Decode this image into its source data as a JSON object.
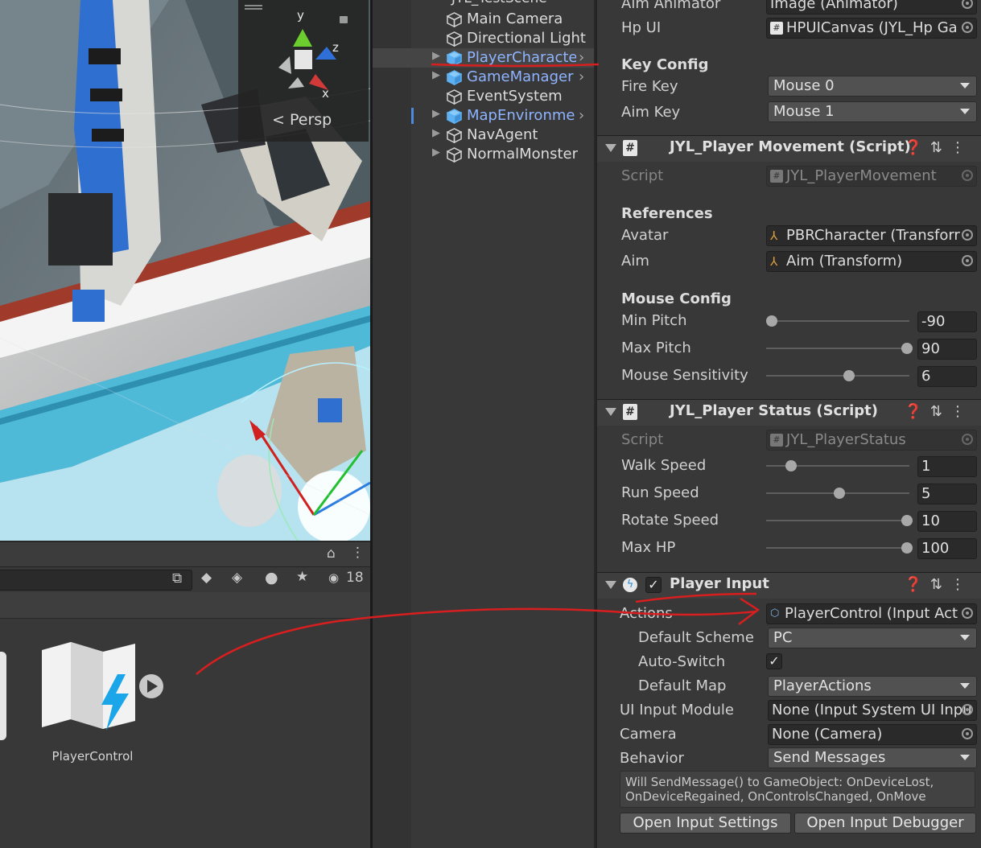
{
  "scene": {
    "gizmo_axes": {
      "x": "x",
      "y": "y",
      "z": "z"
    },
    "projection_label": "Persp"
  },
  "project": {
    "visible_count": "18",
    "asset": {
      "name": "PlayerControl",
      "icon": "input-actions-asset-icon"
    }
  },
  "hierarchy": {
    "scene_name": "JYL_TestScene",
    "items": [
      {
        "name": "Main Camera",
        "prefab": false
      },
      {
        "name": "Directional Light",
        "prefab": false
      },
      {
        "name": "PlayerCharacte",
        "prefab": true,
        "selected": true
      },
      {
        "name": "GameManager",
        "prefab": true
      },
      {
        "name": "EventSystem",
        "prefab": false
      },
      {
        "name": "MapEnvironme",
        "prefab": true
      },
      {
        "name": "NavAgent",
        "prefab": false
      },
      {
        "name": "NormalMonster",
        "prefab": false
      }
    ]
  },
  "inspector": {
    "top": {
      "aim_animator_label": "Aim Animator",
      "aim_animator_value": "Image (Animator)",
      "hp_ui_label": "Hp UI",
      "hp_ui_value": "HPUICanvas (JYL_Hp Ga"
    },
    "key_config": {
      "heading": "Key Config",
      "fire_key_label": "Fire Key",
      "fire_key_value": "Mouse 0",
      "aim_key_label": "Aim Key",
      "aim_key_value": "Mouse 1"
    },
    "movement": {
      "title": "JYL_Player Movement (Script)",
      "script_label": "Script",
      "script_value": "JYL_PlayerMovement",
      "references_heading": "References",
      "avatar_label": "Avatar",
      "avatar_value": "PBRCharacter (Transforr",
      "aim_label": "Aim",
      "aim_value": "Aim (Transform)",
      "mouse_heading": "Mouse Config",
      "sliders": [
        {
          "label": "Min Pitch",
          "value": "-90",
          "fraction": 0.0
        },
        {
          "label": "Max Pitch",
          "value": "90",
          "fraction": 1.0
        },
        {
          "label": "Mouse Sensitivity",
          "value": "6",
          "fraction": 0.57
        }
      ]
    },
    "status": {
      "title": "JYL_Player Status (Script)",
      "script_label": "Script",
      "script_value": "JYL_PlayerStatus",
      "sliders": [
        {
          "label": "Walk Speed",
          "value": "1",
          "fraction": 0.14
        },
        {
          "label": "Run Speed",
          "value": "5",
          "fraction": 0.5
        },
        {
          "label": "Rotate Speed",
          "value": "10",
          "fraction": 1.0
        },
        {
          "label": "Max HP",
          "value": "100",
          "fraction": 1.0
        }
      ]
    },
    "player_input": {
      "title": "Player Input",
      "enabled": true,
      "actions_label": "Actions",
      "actions_value": "PlayerControl (Input Act",
      "default_scheme_label": "Default Scheme",
      "default_scheme_value": "PC",
      "auto_switch_label": "Auto-Switch",
      "auto_switch": true,
      "default_map_label": "Default Map",
      "default_map_value": "PlayerActions",
      "ui_module_label": "UI Input Module",
      "ui_module_value": "None (Input System UI Inpu",
      "camera_label": "Camera",
      "camera_value": "None (Camera)",
      "behavior_label": "Behavior",
      "behavior_value": "Send Messages",
      "help_text": "Will SendMessage() to GameObject: OnDeviceLost, OnDeviceRegained, OnControlsChanged, OnMove",
      "open_settings": "Open Input Settings",
      "open_debugger": "Open Input Debugger"
    }
  },
  "colors": {
    "prefab_text": "#8fb4ff",
    "annotation_red": "#d81e1e"
  }
}
